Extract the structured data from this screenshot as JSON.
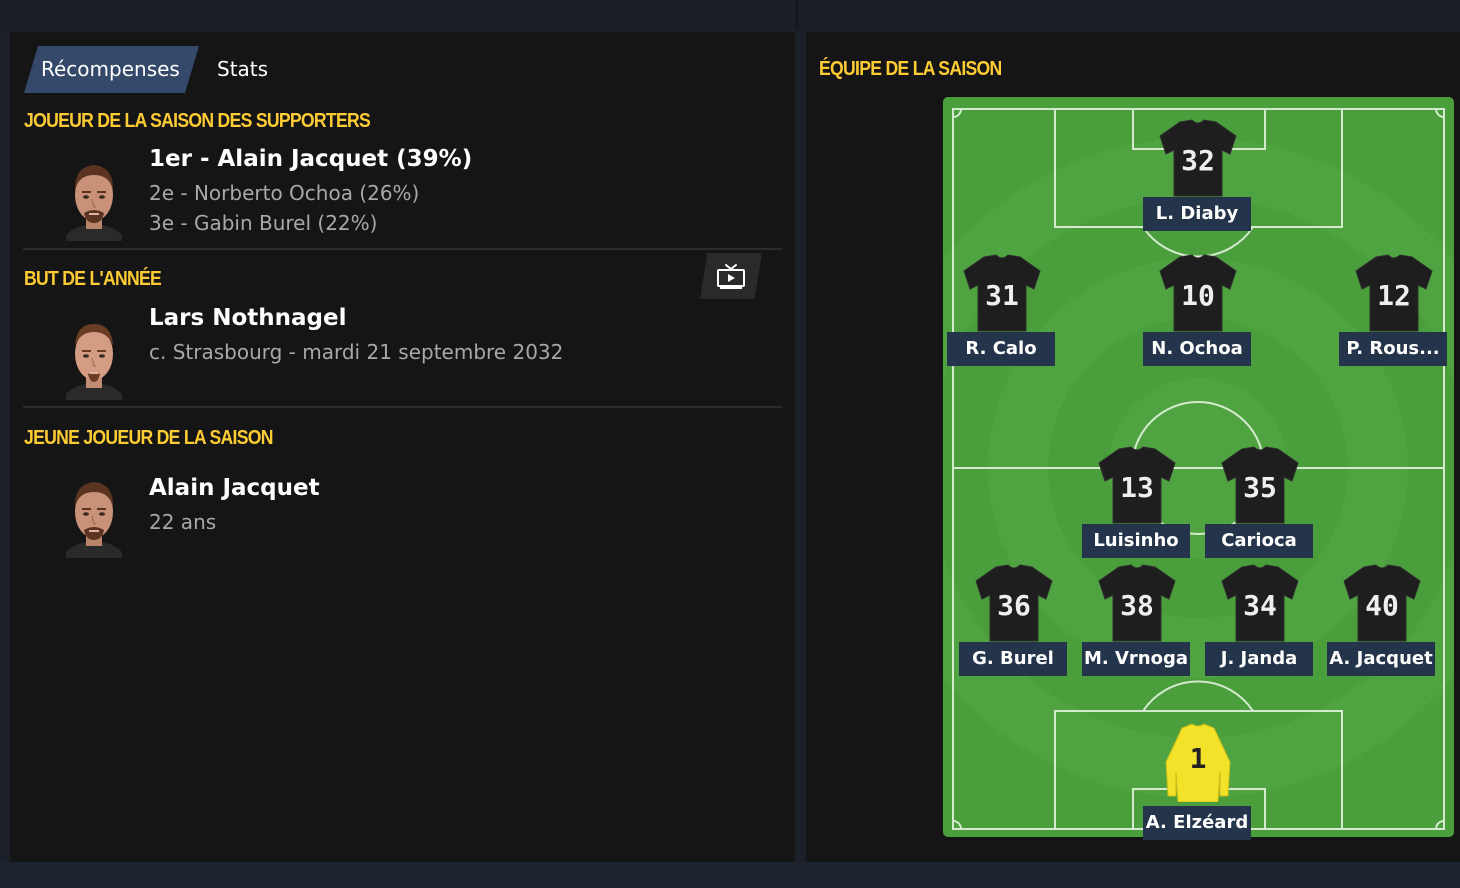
{
  "tabs": {
    "active": "Récompenses",
    "inactive": "Stats"
  },
  "fan_player": {
    "title": "JOUEUR DE LA SAISON DES SUPPORTERS",
    "first": "1er - Alain Jacquet (39%)",
    "second": "2e - Norberto Ochoa (26%)",
    "third": "3e - Gabin Burel (22%)"
  },
  "goal_of_year": {
    "title": "BUT DE L'ANNÉE",
    "player": "Lars Nothnagel",
    "detail": "c. Strasbourg - mardi 21 septembre 2032",
    "video_icon": "tv-play-icon"
  },
  "young_player": {
    "title": "JEUNE JOUEUR DE LA SAISON",
    "player": "Alain Jacquet",
    "age": "22 ans"
  },
  "team_of_season": {
    "title": "ÉQUIPE DE LA SAISON",
    "players": [
      {
        "number": "32",
        "name": "L. Diaby"
      },
      {
        "number": "31",
        "name": "R. Calo"
      },
      {
        "number": "10",
        "name": "N. Ochoa"
      },
      {
        "number": "12",
        "name": "P. Rous..."
      },
      {
        "number": "13",
        "name": "Luisinho"
      },
      {
        "number": "35",
        "name": "Carioca"
      },
      {
        "number": "36",
        "name": "G. Burel"
      },
      {
        "number": "38",
        "name": "M. Vrnoga"
      },
      {
        "number": "34",
        "name": "J. Janda"
      },
      {
        "number": "40",
        "name": "A. Jacquet"
      },
      {
        "number": "1",
        "name": "A. Elzéard"
      }
    ]
  },
  "colors": {
    "accent_yellow": "#ffcc33",
    "tab_active": "#34496a",
    "name_label": "#24344a",
    "pitch_green": "#4a9e3c",
    "goalkeeper_kit": "#f2e22a",
    "outfield_kit": "#1e1e1e"
  }
}
